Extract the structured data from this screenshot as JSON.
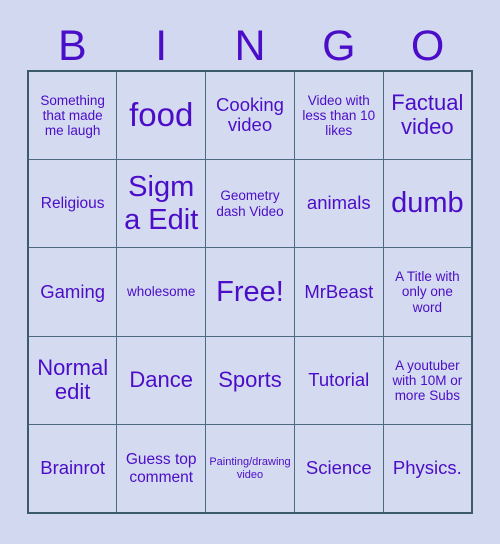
{
  "title": "BINGO Card",
  "colors": {
    "background": "#d1d8f0",
    "cell_background": "#d4daf0",
    "grid_border": "#4d6b80",
    "outer_border": "#3d5a6c",
    "text": "#4b0dc8"
  },
  "header": {
    "letters": [
      "B",
      "I",
      "N",
      "G",
      "O"
    ]
  },
  "grid": {
    "rows": 5,
    "columns": 5,
    "free_space": {
      "row": 2,
      "column": 2,
      "label": "Free!"
    },
    "cells": [
      [
        {
          "label": "Something that made me laugh",
          "size": "sm"
        },
        {
          "label": "food",
          "size": "huge"
        },
        {
          "label": "Cooking video",
          "size": "lg"
        },
        {
          "label": "Video with less than 10 likes",
          "size": "sm"
        },
        {
          "label": "Factual video",
          "size": "xl"
        }
      ],
      [
        {
          "label": "Religious",
          "size": "md"
        },
        {
          "label": "Sigma Edit",
          "size": "xxl"
        },
        {
          "label": "Geometry dash Video",
          "size": "sm"
        },
        {
          "label": "animals",
          "size": "lg"
        },
        {
          "label": "dumb",
          "size": "xxl"
        }
      ],
      [
        {
          "label": "Gaming",
          "size": "lg"
        },
        {
          "label": "wholesome",
          "size": "sm"
        },
        {
          "label": "Free!",
          "size": "xxl"
        },
        {
          "label": "MrBeast",
          "size": "lg"
        },
        {
          "label": "A Title with only one word",
          "size": "sm"
        }
      ],
      [
        {
          "label": "Normal edit",
          "size": "xl"
        },
        {
          "label": "Dance",
          "size": "xl"
        },
        {
          "label": "Sports",
          "size": "xl"
        },
        {
          "label": "Tutorial",
          "size": "lg"
        },
        {
          "label": "A youtuber with 10M or more Subs",
          "size": "sm"
        }
      ],
      [
        {
          "label": "Brainrot",
          "size": "lg"
        },
        {
          "label": "Guess top comment",
          "size": "md"
        },
        {
          "label": "Painting/drawing video",
          "size": "xs"
        },
        {
          "label": "Science",
          "size": "lg"
        },
        {
          "label": "Physics.",
          "size": "lg"
        }
      ]
    ]
  }
}
